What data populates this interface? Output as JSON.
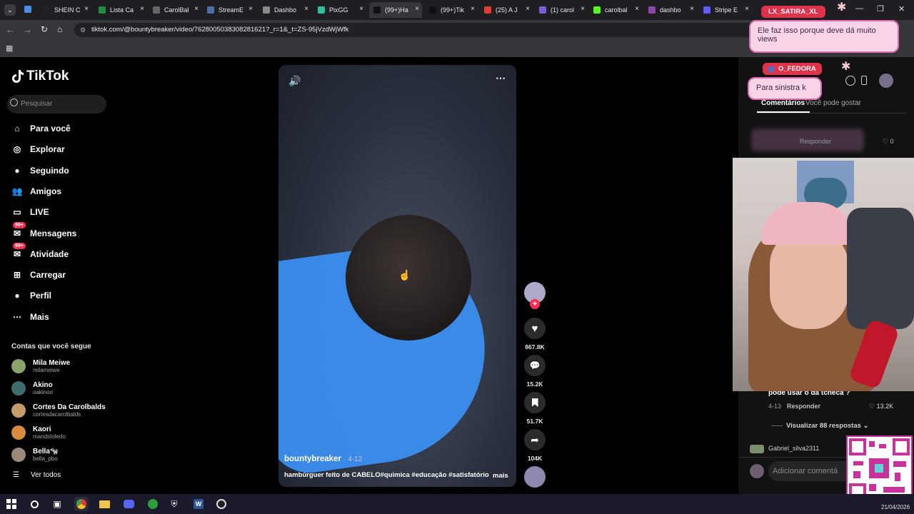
{
  "tabs": [
    {
      "label": "SHEIN C",
      "color": "#222"
    },
    {
      "label": "Lista Ca",
      "color": "#1e8e3e"
    },
    {
      "label": "CarolBal",
      "color": "#666"
    },
    {
      "label": "StreamE",
      "color": "#4a6fa5"
    },
    {
      "label": "Dashbo",
      "color": "#888"
    },
    {
      "label": "PixGG",
      "color": "#2bbf9f"
    },
    {
      "label": "(99+)Ha",
      "color": "#111"
    },
    {
      "label": "(99+)Tik",
      "color": "#111"
    },
    {
      "label": "(25) A J",
      "color": "#e53935"
    },
    {
      "label": "(1) carol",
      "color": "#7b5cd6"
    },
    {
      "label": "carolbal",
      "color": "#53fc18"
    },
    {
      "label": "dashbo",
      "color": "#8e44ad"
    },
    {
      "label": "Stripe E",
      "color": "#635bff"
    }
  ],
  "address": {
    "url": "tiktok.com/@bountybreaker/video/7628005038308281621?_r=1&_t=ZS-95jVzdWjWfk"
  },
  "sidebar": {
    "logo": "TikTok",
    "search_placeholder": "Pesquisar",
    "nav": [
      {
        "label": "Para você",
        "icon": "home-icon"
      },
      {
        "label": "Explorar",
        "icon": "compass-icon"
      },
      {
        "label": "Seguindo",
        "icon": "following-icon"
      },
      {
        "label": "Amigos",
        "icon": "friends-icon"
      },
      {
        "label": "LIVE",
        "icon": "live-icon"
      },
      {
        "label": "Mensagens",
        "icon": "messages-icon",
        "badge": "99+"
      },
      {
        "label": "Atividade",
        "icon": "activity-icon",
        "badge": "99+"
      },
      {
        "label": "Carregar",
        "icon": "upload-icon"
      },
      {
        "label": "Perfil",
        "icon": "profile-icon"
      },
      {
        "label": "Mais",
        "icon": "more-icon"
      }
    ],
    "following_header": "Contas que você segue",
    "accounts": [
      {
        "name": "Mila Meiwe",
        "handle": "milameiwe",
        "color": "#8aa36b"
      },
      {
        "name": "Akino",
        "handle": "oakinoo",
        "color": "#3e6b6b"
      },
      {
        "name": "Cortes Da Carolbalds",
        "handle": "cortesdacarolbalds",
        "color": "#c79b6a"
      },
      {
        "name": "Kaori",
        "handle": "mandstoledo",
        "color": "#d98a3a"
      },
      {
        "name": "Bella🐄",
        "handle": "bella_pbo",
        "color": "#9b8a7a"
      }
    ],
    "see_all": "Ver todos"
  },
  "video": {
    "author": "bountybreaker",
    "date": "· 4-12",
    "caption": "hambúrguer feito de CABELO#quimica #educação #satisfatório",
    "more": "mais"
  },
  "actions": {
    "likes": "867.8K",
    "comments": "15.2K",
    "saves": "51.7K",
    "shares": "104K"
  },
  "overlay": {
    "alert1_user": "LX_SATIRA_XL",
    "alert1_msg": "Ele faz isso porque deve dá muito views",
    "alert2_user": "O_FEDORA",
    "alert2_msg": "Para sinistra k"
  },
  "comments_panel": {
    "tab_comments": "Comentários",
    "tab_like": "Você pode gostar",
    "blur_reply": "Responder",
    "blur_likes": "0",
    "comment_text": "pode usar o da tcheca ?",
    "comment_date": "4-13",
    "comment_reply": "Responder",
    "comment_likes": "13.2K",
    "view_replies": "Visualizar 88 respostas",
    "next_user": "Gabriel_silva2311",
    "add_comment_placeholder": "Adicionar comentá"
  },
  "taskbar": {
    "date": "21/04/2026"
  }
}
